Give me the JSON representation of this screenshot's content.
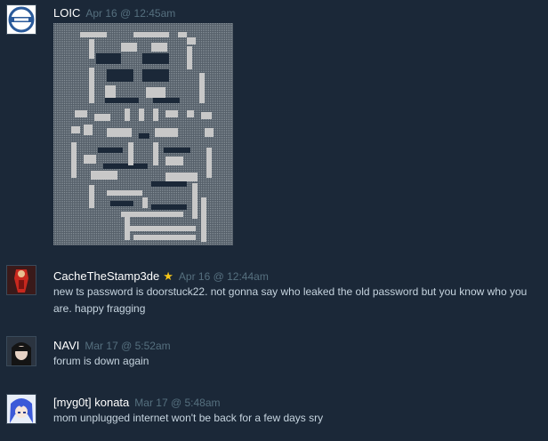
{
  "comments": [
    {
      "author": "LOIC",
      "timestamp": "Apr 16 @ 12:45am",
      "text": "",
      "avatar_icon": "loic-logo-icon",
      "badge": ""
    },
    {
      "author": "CacheTheStamp3de",
      "timestamp": "Apr 16 @ 12:44am",
      "text": "new ts password is doorstuck22. not gonna say who leaked the old password but you know who you are. happy fragging",
      "avatar_icon": "red-character-avatar",
      "badge": "★"
    },
    {
      "author": "NAVI",
      "timestamp": "Mar 17 @ 5:52am",
      "text": "forum is down again",
      "avatar_icon": "dark-anime-avatar",
      "badge": ""
    },
    {
      "author": "[myg0t] konata",
      "timestamp": "Mar 17 @ 5:48am",
      "text": "mom unplugged internet won't be back for a few days sry",
      "avatar_icon": "blue-anime-avatar",
      "badge": ""
    }
  ],
  "colors": {
    "background": "#1b2838",
    "author": "#ffffff",
    "timestamp": "#56707f",
    "text": "#c6d4df",
    "star": "#f5c518",
    "ascii_light": "#c8c8c8",
    "ascii_dark": "#1b2838"
  }
}
